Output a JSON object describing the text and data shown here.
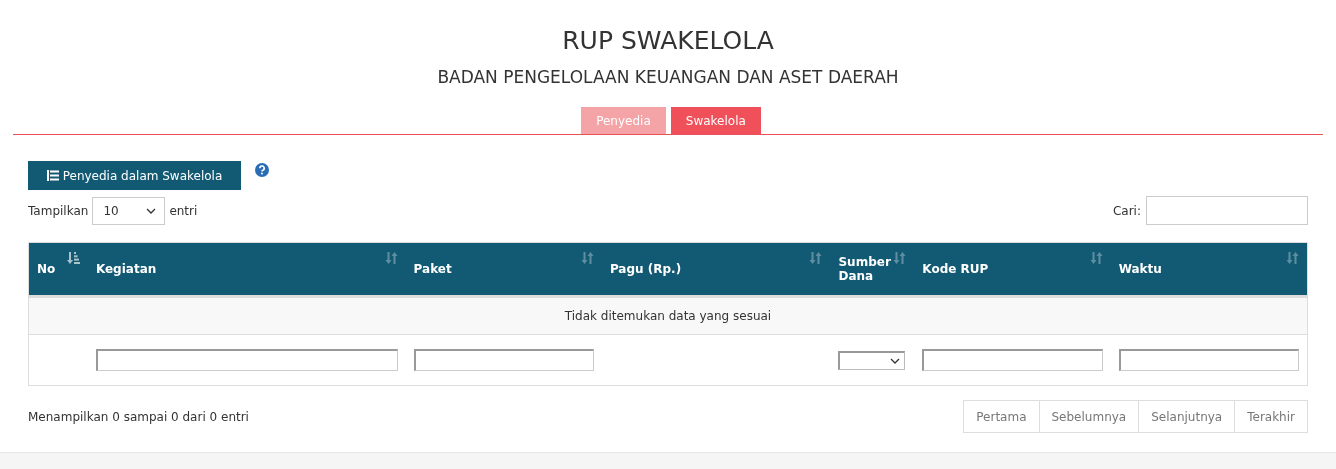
{
  "title": "RUP SWAKELOLA",
  "subtitle": "BADAN PENGELOLAAN KEUANGAN DAN ASET DAERAH",
  "tabs": [
    {
      "label": "Penyedia",
      "selected": false
    },
    {
      "label": "Swakelola",
      "selected": true
    }
  ],
  "action_button": {
    "label": "Penyedia dalam Swakelola"
  },
  "length_menu": {
    "prefix": "Tampilkan",
    "value": "10",
    "suffix": "entri"
  },
  "search": {
    "label": "Cari:"
  },
  "table": {
    "columns": [
      {
        "label": "No",
        "sorted": true
      },
      {
        "label": "Kegiatan",
        "sorted": false,
        "filter": {
          "kind": "text"
        }
      },
      {
        "label": "Paket",
        "sorted": false,
        "filter": {
          "kind": "text"
        }
      },
      {
        "label": "Pagu (Rp.)",
        "sorted": false
      },
      {
        "label": "Sumber Dana",
        "sorted": false,
        "filter": {
          "kind": "select"
        }
      },
      {
        "label": "Kode RUP",
        "sorted": false,
        "filter": {
          "kind": "text"
        }
      },
      {
        "label": "Waktu",
        "sorted": false,
        "filter": {
          "kind": "text"
        }
      }
    ],
    "empty_message": "Tidak ditemukan data yang sesuai"
  },
  "info": "Menampilkan 0 sampai 0 dari 0 entri",
  "pagination": [
    {
      "label": "Pertama",
      "disabled": true
    },
    {
      "label": "Sebelumnya",
      "disabled": true
    },
    {
      "label": "Selanjutnya",
      "disabled": true
    },
    {
      "label": "Terakhir",
      "disabled": true
    }
  ]
}
